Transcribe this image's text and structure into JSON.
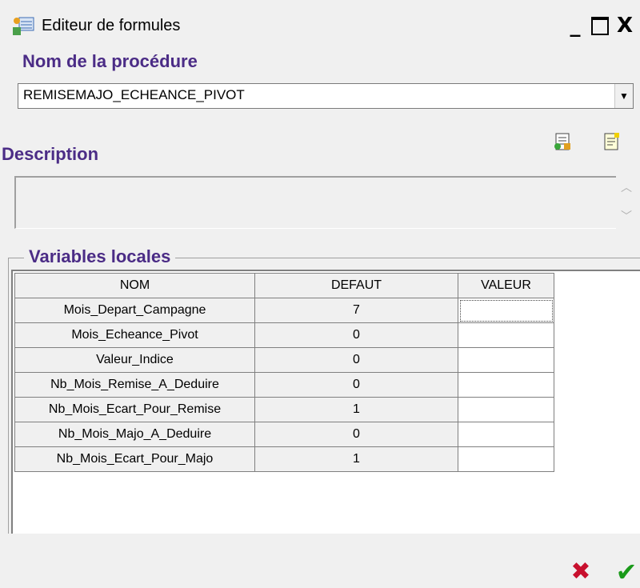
{
  "window": {
    "title": "Editeur de formules",
    "minimize": "_",
    "close": "X"
  },
  "procedure": {
    "label": "Nom de la procédure",
    "value": "REMISEMAJO_ECHEANCE_PIVOT"
  },
  "description": {
    "label": "Description",
    "value": ""
  },
  "variables": {
    "label": "Variables locales",
    "columns": [
      "NOM",
      "DEFAUT",
      "VALEUR"
    ],
    "rows": [
      {
        "nom": "Mois_Depart_Campagne",
        "defaut": "7",
        "valeur": ""
      },
      {
        "nom": "Mois_Echeance_Pivot",
        "defaut": "0",
        "valeur": ""
      },
      {
        "nom": "Valeur_Indice",
        "defaut": "0",
        "valeur": ""
      },
      {
        "nom": "Nb_Mois_Remise_A_Deduire",
        "defaut": "0",
        "valeur": ""
      },
      {
        "nom": "Nb_Mois_Ecart_Pour_Remise",
        "defaut": "1",
        "valeur": ""
      },
      {
        "nom": "Nb_Mois_Majo_A_Deduire",
        "defaut": "0",
        "valeur": ""
      },
      {
        "nom": "Nb_Mois_Ecart_Pour_Majo",
        "defaut": "1",
        "valeur": ""
      }
    ]
  },
  "colors": {
    "label": "#4b2c86",
    "cancel": "#c8102e",
    "ok": "#1a9a1a"
  },
  "icons": {
    "app": "formula-editor-icon",
    "tool1": "import-icon",
    "tool2": "document-icon",
    "cancel": "cancel-x-icon",
    "ok": "checkmark-icon"
  }
}
